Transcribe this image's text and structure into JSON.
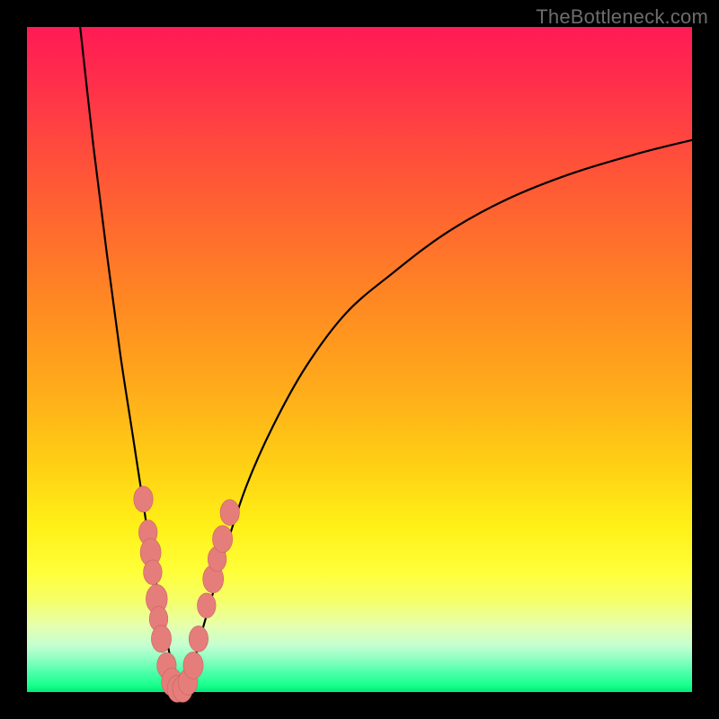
{
  "watermark": "TheBottleneck.com",
  "colors": {
    "frame": "#000000",
    "watermark": "#6c6c6c",
    "curve": "#000000",
    "dot_fill": "#e57d7a",
    "dot_stroke": "#c96562"
  },
  "chart_data": {
    "type": "line",
    "title": "",
    "xlabel": "",
    "ylabel": "",
    "xlim": [
      0,
      100
    ],
    "ylim": [
      0,
      100
    ],
    "notes": "V-shaped bottleneck curve. Y ≈ absolute mismatch (%) vs an unlabeled X axis. Minimum (0%) near x≈23. Left branch rises to ~100% at x≈8. Right branch rises asymptotically toward ~83% at x=100. Values estimated from pixel positions.",
    "series": [
      {
        "name": "bottleneck-curve",
        "x": [
          8,
          10,
          12,
          14,
          16,
          18,
          19,
          20,
          21,
          22,
          23,
          24,
          25,
          26,
          28,
          30,
          33,
          37,
          42,
          48,
          55,
          63,
          72,
          82,
          92,
          100
        ],
        "y": [
          100,
          82,
          66,
          51,
          38,
          25,
          19,
          13,
          8,
          3,
          0,
          1,
          4,
          8,
          15,
          22,
          31,
          40,
          49,
          57,
          63,
          69,
          74,
          78,
          81,
          83
        ]
      }
    ],
    "markers": [
      {
        "x": 17.5,
        "y": 29,
        "r": 1.4
      },
      {
        "x": 18.2,
        "y": 24,
        "r": 1.3
      },
      {
        "x": 18.6,
        "y": 21,
        "r": 1.6
      },
      {
        "x": 18.9,
        "y": 18,
        "r": 1.3
      },
      {
        "x": 19.5,
        "y": 14,
        "r": 1.7
      },
      {
        "x": 19.8,
        "y": 11,
        "r": 1.3
      },
      {
        "x": 20.2,
        "y": 8,
        "r": 1.5
      },
      {
        "x": 21.0,
        "y": 4,
        "r": 1.4
      },
      {
        "x": 21.8,
        "y": 1.5,
        "r": 1.6
      },
      {
        "x": 22.6,
        "y": 0.5,
        "r": 1.5
      },
      {
        "x": 23.4,
        "y": 0.5,
        "r": 1.5
      },
      {
        "x": 24.2,
        "y": 1.5,
        "r": 1.4
      },
      {
        "x": 25.0,
        "y": 4,
        "r": 1.5
      },
      {
        "x": 25.8,
        "y": 8,
        "r": 1.4
      },
      {
        "x": 27.0,
        "y": 13,
        "r": 1.3
      },
      {
        "x": 28.0,
        "y": 17,
        "r": 1.6
      },
      {
        "x": 28.6,
        "y": 20,
        "r": 1.3
      },
      {
        "x": 29.4,
        "y": 23,
        "r": 1.5
      },
      {
        "x": 30.5,
        "y": 27,
        "r": 1.4
      }
    ]
  }
}
